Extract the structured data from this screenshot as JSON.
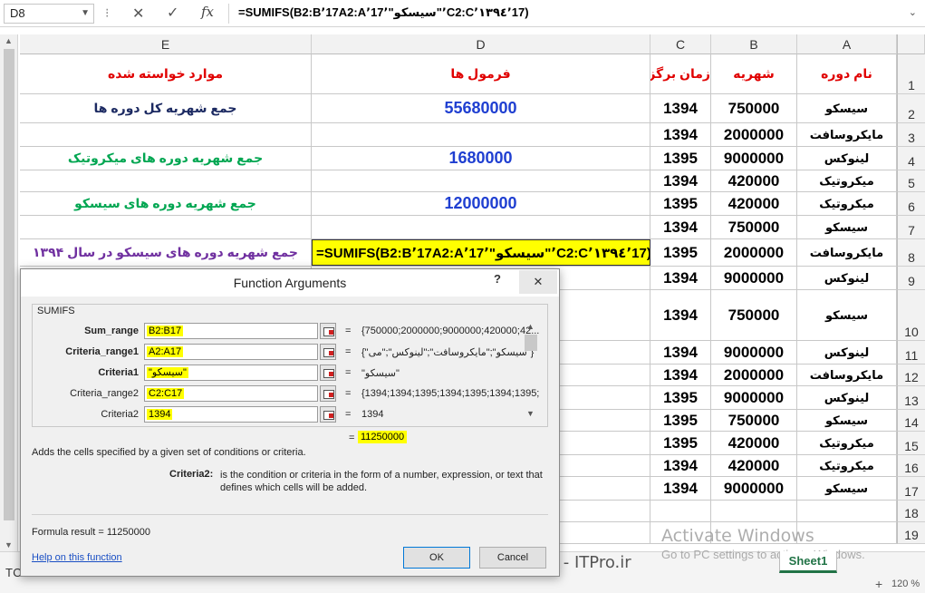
{
  "formula_bar": {
    "name_box": "D8",
    "formula": "=SUMIFS(B2:B٬17A2:A٬17٬\"سیسکو\"٬C2:C٬١٣٩٤٬17)"
  },
  "columns": [
    "E",
    "D",
    "C",
    "B",
    "A"
  ],
  "row_numbers": [
    "1",
    "2",
    "3",
    "4",
    "5",
    "6",
    "7",
    "8",
    "9",
    "10",
    "11",
    "12",
    "13",
    "14",
    "15",
    "16",
    "17",
    "18",
    "19"
  ],
  "rows": [
    {
      "E": "موارد خواسته شده",
      "D": "فرمول ها",
      "C": "زمان برگزاری",
      "B": "شهریه",
      "A": "نام دوره"
    },
    {
      "E": "جمع شهریه کل دوره ها",
      "D": "55680000",
      "C": "1394",
      "B": "750000",
      "A": "سیسکو"
    },
    {
      "E": "",
      "D": "",
      "C": "1394",
      "B": "2000000",
      "A": "مایکروسافت"
    },
    {
      "E": "جمع شهریه دوره های میکروتیک",
      "D": "1680000",
      "C": "1395",
      "B": "9000000",
      "A": "لینوکس"
    },
    {
      "E": "",
      "D": "",
      "C": "1394",
      "B": "420000",
      "A": "میکروتیک"
    },
    {
      "E": "جمع شهریه دوره های سیسکو",
      "D": "12000000",
      "C": "1395",
      "B": "420000",
      "A": "میکروتیک"
    },
    {
      "E": "",
      "D": "",
      "C": "1394",
      "B": "750000",
      "A": "سیسکو"
    },
    {
      "E": "جمع شهریه دوره های سیسکو در سال ۱۳۹۴",
      "D": "=SUMIFS(B2:B٬17A2:A٬17٬\"سیسکو\"٬C2:C٬١٣٩٤٬17)",
      "C": "1395",
      "B": "2000000",
      "A": "مایکروسافت"
    },
    {
      "E": "",
      "D": "",
      "C": "1394",
      "B": "9000000",
      "A": "لینوکس"
    },
    {
      "E": "",
      "D": "",
      "C": "1394",
      "B": "750000",
      "A": "سیسکو"
    },
    {
      "E": "",
      "D": "",
      "C": "1394",
      "B": "9000000",
      "A": "لینوکس"
    },
    {
      "E": "",
      "D": "",
      "C": "1394",
      "B": "2000000",
      "A": "مایکروسافت"
    },
    {
      "E": "",
      "D": "",
      "C": "1395",
      "B": "9000000",
      "A": "لینوکس"
    },
    {
      "E": "",
      "D": "",
      "C": "1395",
      "B": "750000",
      "A": "سیسکو"
    },
    {
      "E": "",
      "D": "",
      "C": "1395",
      "B": "420000",
      "A": "میکروتیک"
    },
    {
      "E": "",
      "D": "",
      "C": "1394",
      "B": "420000",
      "A": "میکروتیک"
    },
    {
      "E": "",
      "D": "",
      "C": "1394",
      "B": "9000000",
      "A": "سیسکو"
    },
    {
      "E": "",
      "D": "",
      "C": "",
      "B": "",
      "A": ""
    },
    {
      "E": "",
      "D": "",
      "C": "",
      "B": "",
      "A": ""
    }
  ],
  "dialog": {
    "title": "Function Arguments",
    "help_glyph": "?",
    "close_glyph": "✕",
    "function_name": "SUMIFS",
    "args": [
      {
        "label": "Sum_range",
        "value": "B2:B17",
        "result": "{750000;2000000;9000000;420000;42..."
      },
      {
        "label": "Criteria_range1",
        "value": "A2:A17",
        "result": "{\"سیسکو\";\"مایکروسافت\";\"لینوکس\";\"می\"}"
      },
      {
        "label": "Criteria1",
        "value": "\"سیسکو\"",
        "result": "\"سیسکو\""
      },
      {
        "label": "Criteria_range2",
        "value": "C2:C17",
        "result": "{1394;1394;1395;1394;1395;1394;1395;"
      },
      {
        "label": "Criteria2",
        "value": "1394",
        "result": "1394"
      }
    ],
    "result_value": "11250000",
    "description": "Adds the cells specified by a given set of conditions or criteria.",
    "criteria_label": "Criteria2:",
    "criteria_text": "is the condition or criteria in the form of a number, expression, or text that defines which cells will be added.",
    "formula_result_label": "Formula result =",
    "formula_result_value": "11250000",
    "help_link": "Help on this function",
    "ok_label": "OK",
    "cancel_label": "Cancel"
  },
  "sheet_tab": "Sheet1",
  "watermark": "وب سایت تخصصی فناوری اطلاعات ایران - ITPro.ir",
  "tosinso": "TOSINSO.COM",
  "activate_title": "Activate Windows",
  "activate_sub": "Go to PC settings to activate Windows.",
  "zoom": "120 %",
  "zoom_plus": "+",
  "colors": {
    "header_red": "#e00000",
    "blue": "#1f3fd1",
    "green": "#00a651",
    "purple": "#7030a0",
    "navy": "#1c2a62",
    "highlight": "#ffff00"
  }
}
